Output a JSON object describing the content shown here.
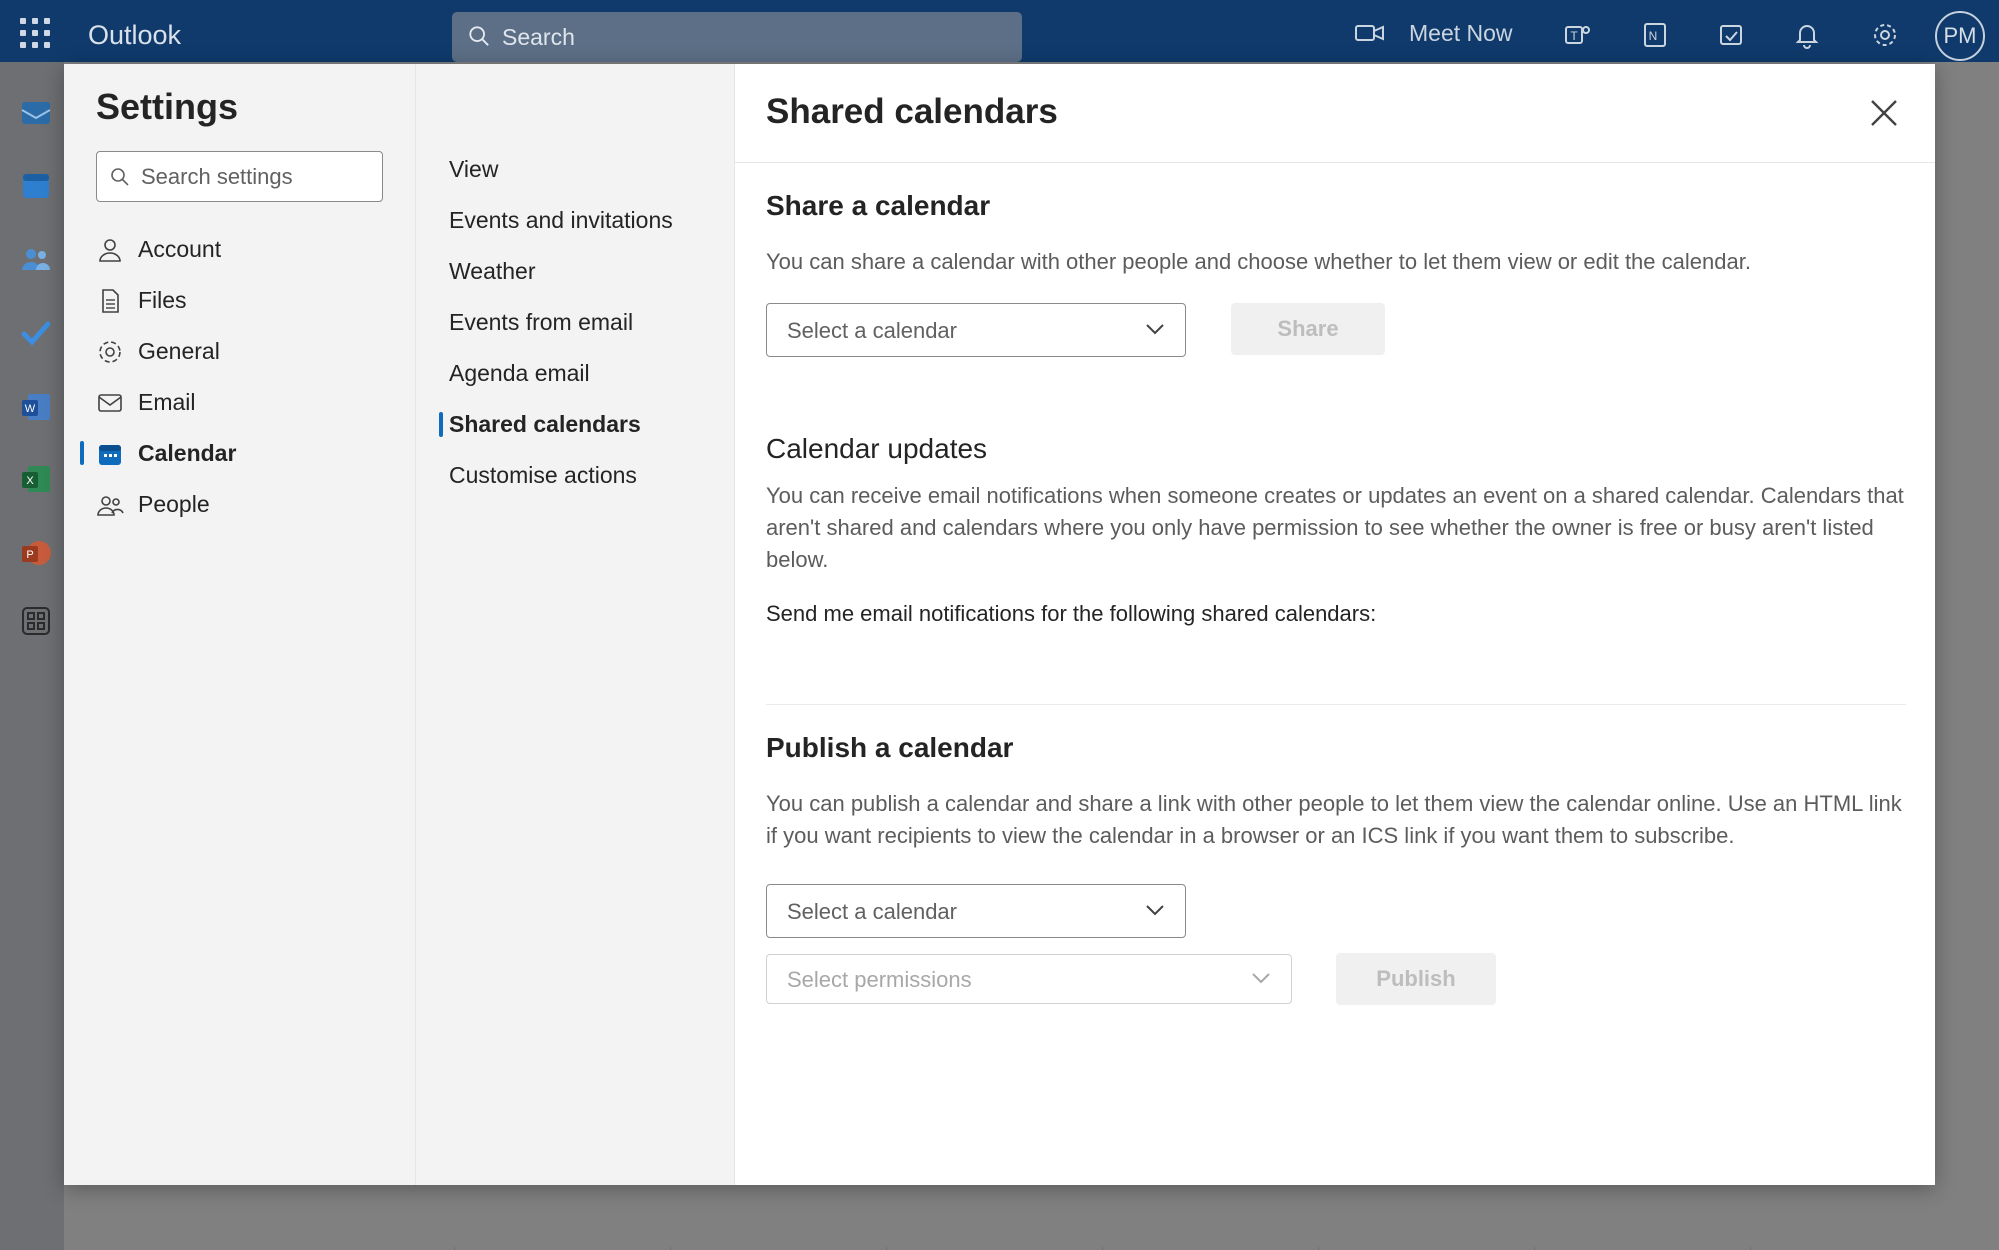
{
  "topbar": {
    "app_name": "Outlook",
    "search_placeholder": "Search",
    "meet_now_label": "Meet Now",
    "avatar_initials": "PM"
  },
  "settings": {
    "title": "Settings",
    "search_placeholder": "Search settings",
    "categories": [
      {
        "label": "Account",
        "icon": "person-icon"
      },
      {
        "label": "Files",
        "icon": "file-icon"
      },
      {
        "label": "General",
        "icon": "gear-icon"
      },
      {
        "label": "Email",
        "icon": "mail-icon"
      },
      {
        "label": "Calendar",
        "icon": "calendar-icon",
        "active": true
      },
      {
        "label": "People",
        "icon": "people-icon"
      }
    ],
    "subsections": [
      {
        "label": "View"
      },
      {
        "label": "Events and invitations"
      },
      {
        "label": "Weather"
      },
      {
        "label": "Events from email"
      },
      {
        "label": "Agenda email"
      },
      {
        "label": "Shared calendars",
        "active": true
      },
      {
        "label": "Customise actions"
      }
    ]
  },
  "page": {
    "title": "Shared calendars",
    "share": {
      "heading": "Share a calendar",
      "description": "You can share a calendar with other people and choose whether to let them view or edit the calendar.",
      "select_placeholder": "Select a calendar",
      "share_button": "Share"
    },
    "updates": {
      "heading": "Calendar updates",
      "description": "You can receive email notifications when someone creates or updates an event on a shared calendar. Calendars that aren't shared and calendars where you only have permission to see whether the owner is free or busy aren't listed below.",
      "notify_label": "Send me email notifications for the following shared calendars:"
    },
    "publish": {
      "heading": "Publish a calendar",
      "description": "You can publish a calendar and share a link with other people to let them view the calendar online. Use an HTML link if you want recipients to view the calendar in a browser or an ICS link if you want them to subscribe.",
      "select_calendar_placeholder": "Select a calendar",
      "select_permissions_placeholder": "Select permissions",
      "publish_button": "Publish"
    }
  },
  "colors": {
    "topbar": "#0f3a6b",
    "accent": "#0f6cbd"
  }
}
